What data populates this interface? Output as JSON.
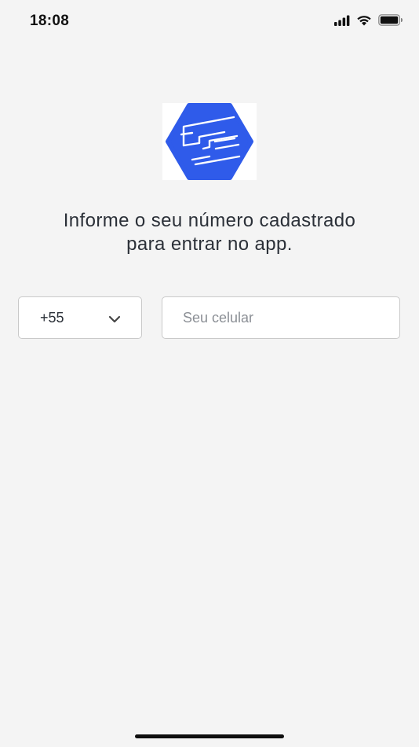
{
  "status_bar": {
    "time": "18:08",
    "icons": [
      "signal-icon",
      "wifi-icon",
      "battery-icon"
    ]
  },
  "logo": {
    "icon": "app-logo-icon",
    "color": "#2f5bea"
  },
  "prompt": {
    "line1": "Informe o seu número cadastrado",
    "line2": "para entrar no app."
  },
  "phone_form": {
    "country_code": "+55",
    "country_icon": "chevron-down-icon",
    "phone_placeholder": "Seu celular",
    "phone_value": ""
  }
}
